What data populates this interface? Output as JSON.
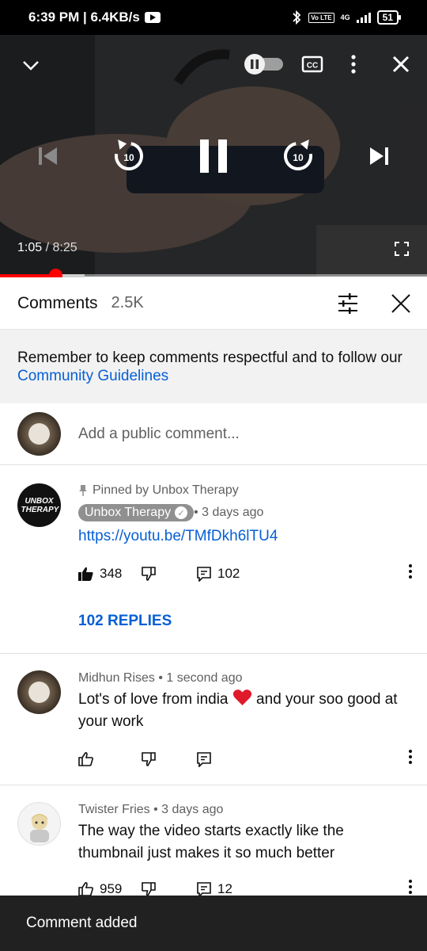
{
  "status": {
    "time_speed": "6:39 PM | 6.4KB/s",
    "network": "4G",
    "volte": "Vo LTE",
    "battery": "51"
  },
  "player": {
    "current_time": "1:05",
    "separator": " / ",
    "duration": "8:25",
    "progress_fraction": 0.129,
    "buffer_fraction": 0.198,
    "skip_label": "10"
  },
  "header": {
    "title": "Comments",
    "count": "2.5K"
  },
  "notice": {
    "text": "Remember to keep comments respectful and to follow our ",
    "link": "Community Guidelines"
  },
  "add_comment": {
    "placeholder": "Add a public comment..."
  },
  "comments": [
    {
      "pinned_label": "Pinned by Unbox Therapy",
      "author": "Unbox Therapy",
      "age": " • 3 days ago",
      "link": "https://youtu.be/TMfDkh6lTU4",
      "likes": "348",
      "replies_count": "102",
      "replies_label": "102 REPLIES",
      "avatar_text": "UNBOX THERAPY"
    },
    {
      "author_age": "Midhun Rises • 1 second ago",
      "text_before": "Lot's of love from india ",
      "text_after": " and your soo good at your work",
      "likes": "",
      "replies_count": ""
    },
    {
      "author_age": "Twister Fries • 3 days ago",
      "text": "The way the video starts exactly like the thumbnail just makes it so much better",
      "likes": "959",
      "replies_count": "12"
    }
  ],
  "toast": {
    "text": "Comment added"
  },
  "colors": {
    "accent_red": "#ff0000",
    "link_blue": "#065fd4",
    "heart": "#e0192b"
  }
}
